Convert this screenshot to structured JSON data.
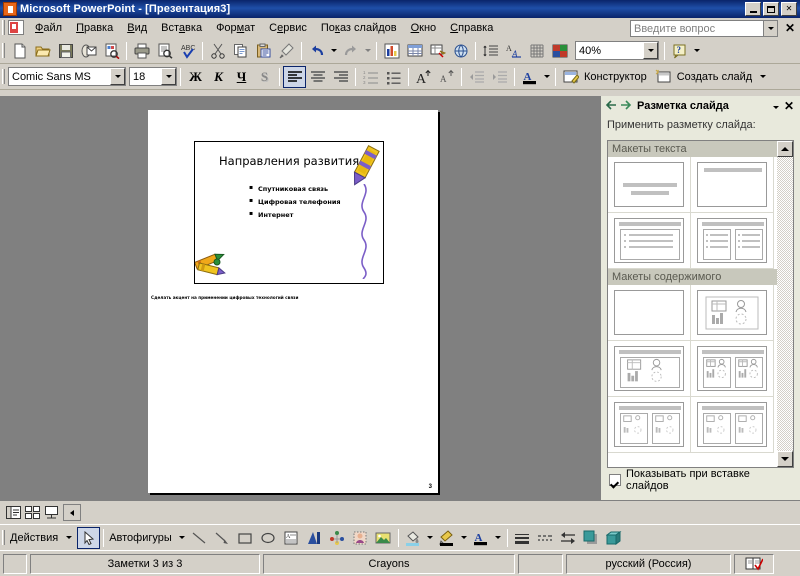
{
  "window": {
    "title": "Microsoft PowerPoint - [Презентация3]",
    "app_icon": "powerpoint-icon",
    "minimize": "minimize-icon",
    "maximize": "maximize-icon",
    "close": "close-icon"
  },
  "menu": {
    "doc_icon": "document-icon",
    "items": [
      {
        "label": "Файл"
      },
      {
        "label": "Правка"
      },
      {
        "label": "Вид"
      },
      {
        "label": "Вставка"
      },
      {
        "label": "Формат"
      },
      {
        "label": "Сервис"
      },
      {
        "label": "Показ слайдов"
      },
      {
        "label": "Окно"
      },
      {
        "label": "Справка"
      }
    ],
    "ask_placeholder": "Введите вопрос",
    "close_label": "✕"
  },
  "standard_toolbar": {
    "buttons": [
      {
        "name": "new-document-icon"
      },
      {
        "name": "open-folder-icon"
      },
      {
        "name": "save-icon"
      },
      {
        "name": "email-icon"
      },
      {
        "name": "search-file-icon"
      },
      {
        "name": "print-icon"
      },
      {
        "name": "print-preview-icon"
      },
      {
        "name": "spellcheck-icon"
      },
      {
        "name": "cut-icon"
      },
      {
        "name": "copy-icon"
      },
      {
        "name": "paste-icon"
      },
      {
        "name": "format-painter-icon"
      },
      {
        "name": "undo-icon"
      },
      {
        "name": "redo-icon"
      },
      {
        "name": "chart-icon"
      },
      {
        "name": "table-icon"
      },
      {
        "name": "insert-table-icon"
      },
      {
        "name": "hyperlink-icon"
      },
      {
        "name": "expand-all-icon"
      },
      {
        "name": "show-formatting-icon"
      },
      {
        "name": "grid-icon"
      },
      {
        "name": "color-scheme-icon"
      },
      {
        "name": "help-icon"
      }
    ],
    "zoom_value": "40%"
  },
  "format_toolbar": {
    "font_name": "Comic Sans MS",
    "font_size": "18",
    "bold_label": "Ж",
    "italic_label": "К",
    "underline_label": "Ч",
    "shadow_label": "S",
    "align_left": "align-left-icon",
    "align_center": "align-center-icon",
    "align_right": "align-right-icon",
    "numbered_list": "numbered-list-icon",
    "bulleted_list": "bulleted-list-icon",
    "grow_font": "increase-font-icon",
    "shrink_font": "decrease-font-icon",
    "decrease_indent": "decrease-indent-icon",
    "increase_indent": "increase-indent-icon",
    "font_color": "font-color-icon",
    "designer_label": "Конструктор",
    "new_slide_label": "Создать слайд"
  },
  "slide": {
    "title": "Направления развития",
    "bullets": [
      "Спутниковая связь",
      "Цифровая телефония",
      "Интернет"
    ],
    "notes": "Сделать акцент на применении цифровых технологий связи",
    "page_number": "3",
    "decor": {
      "crayon_top_right": "crayon-icon",
      "crayon_bottom_left": "crayons-icon",
      "squiggle": "squiggle-line-icon"
    }
  },
  "task_pane": {
    "back_icon": "back-arrow-icon",
    "forward_icon": "forward-arrow-icon",
    "title": "Разметка слайда",
    "menu_icon": "chevron-down-icon",
    "close_icon": "close-icon",
    "subtitle": "Применить разметку слайда:",
    "groups": [
      {
        "label": "Макеты текста"
      },
      {
        "label": "Макеты содержимого"
      }
    ],
    "show_on_insert_label": "Показывать при вставке слайдов",
    "show_on_insert_checked": true
  },
  "view_buttons": [
    {
      "name": "normal-view-button"
    },
    {
      "name": "slide-sorter-view-button"
    },
    {
      "name": "slide-show-view-button"
    }
  ],
  "draw_toolbar": {
    "actions_label": "Действия",
    "select_icon": "select-arrow-icon",
    "autoshapes_label": "Автофигуры",
    "buttons": [
      {
        "name": "line-icon"
      },
      {
        "name": "arrow-icon"
      },
      {
        "name": "rectangle-icon"
      },
      {
        "name": "oval-icon"
      },
      {
        "name": "text-box-icon"
      },
      {
        "name": "wordart-icon"
      },
      {
        "name": "diagram-icon"
      },
      {
        "name": "clipart-icon"
      },
      {
        "name": "picture-icon"
      },
      {
        "name": "fill-color-icon"
      },
      {
        "name": "line-color-icon"
      },
      {
        "name": "font-color-icon"
      },
      {
        "name": "line-style-icon"
      },
      {
        "name": "dash-style-icon"
      },
      {
        "name": "arrow-style-icon"
      },
      {
        "name": "shadow-style-icon"
      },
      {
        "name": "3d-style-icon"
      }
    ]
  },
  "status_bar": {
    "notes_status": "Заметки 3 из 3",
    "design_template": "Crayons",
    "language": "русский (Россия)",
    "spell_icon": "spellcheck-book-icon"
  },
  "colors": {
    "title_bar_start": "#0a246a",
    "title_bar_end": "#1f4fa8",
    "face": "#d4d0c8",
    "task_pane_bg": "#e8e9dc",
    "work_area": "#808080",
    "accent": "#7b5ec7"
  }
}
